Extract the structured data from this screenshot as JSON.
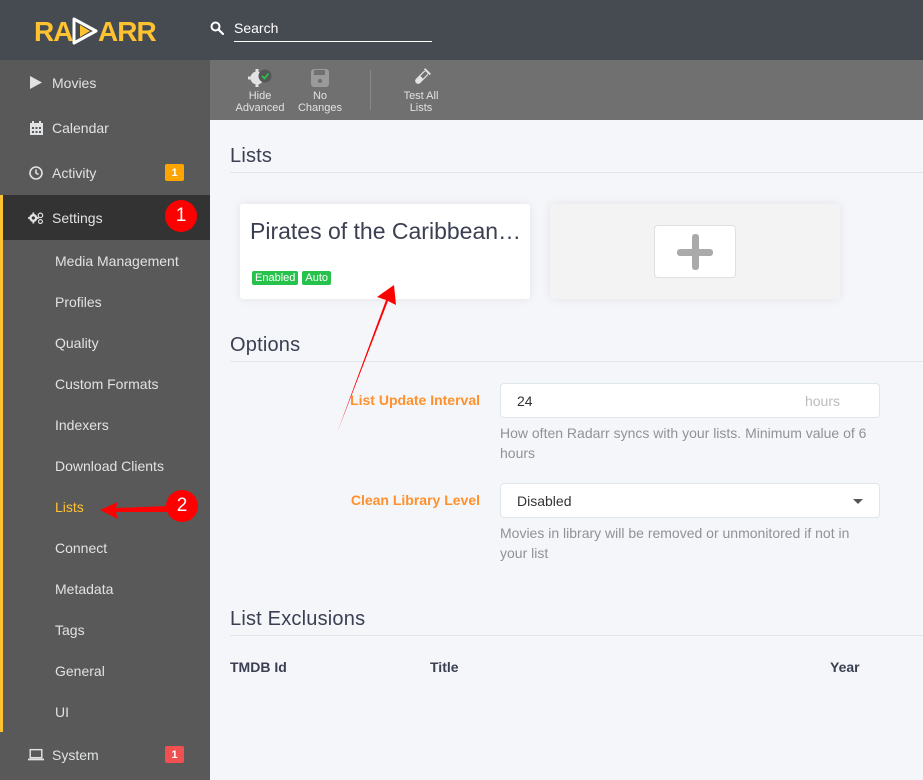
{
  "header": {
    "logo_text": "RADARR",
    "search_placeholder": "Search"
  },
  "sidebar": {
    "items": [
      {
        "label": "Movies",
        "icon": "play-icon"
      },
      {
        "label": "Calendar",
        "icon": "calendar-icon"
      },
      {
        "label": "Activity",
        "icon": "clock-icon",
        "badge": "1",
        "badge_color": "#ffa500"
      },
      {
        "label": "Settings",
        "icon": "gears-icon",
        "active": true
      },
      {
        "label": "System",
        "icon": "laptop-icon",
        "badge": "1",
        "badge_color": "#f05050"
      }
    ],
    "settings_sub": [
      {
        "label": "Media Management"
      },
      {
        "label": "Profiles"
      },
      {
        "label": "Quality"
      },
      {
        "label": "Custom Formats"
      },
      {
        "label": "Indexers"
      },
      {
        "label": "Download Clients"
      },
      {
        "label": "Lists",
        "current": true
      },
      {
        "label": "Connect"
      },
      {
        "label": "Metadata"
      },
      {
        "label": "Tags"
      },
      {
        "label": "General"
      },
      {
        "label": "UI"
      }
    ]
  },
  "toolbar": {
    "buttons": [
      {
        "line1": "Hide",
        "line2": "Advanced",
        "icon": "advanced-settings-icon"
      },
      {
        "line1": "No",
        "line2": "Changes",
        "icon": "save-icon"
      },
      {
        "line1": "Test All",
        "line2": "Lists",
        "icon": "test-tube-icon"
      }
    ]
  },
  "lists_section": {
    "title": "Lists",
    "cards": [
      {
        "name": "Pirates of the Caribbean…",
        "tags": [
          "Enabled",
          "Auto"
        ]
      }
    ],
    "add_icon": "plus-icon"
  },
  "options_section": {
    "title": "Options",
    "fields": [
      {
        "label": "List Update Interval",
        "value": "24",
        "unit": "hours",
        "help": "How often Radarr syncs with your lists. Minimum value of 6 hours"
      },
      {
        "label": "Clean Library Level",
        "value": "Disabled",
        "help": "Movies in library will be removed or unmonitored if not in your list"
      }
    ]
  },
  "exclusions_section": {
    "title": "List Exclusions",
    "columns": [
      "TMDB Id",
      "Title",
      "Year"
    ]
  },
  "annotations": {
    "step1": "1",
    "step2": "2"
  },
  "colors": {
    "accent": "#ffc230",
    "label_orange": "#ff902b",
    "tag_green": "#27c24c",
    "annotation_red": "#ff0000"
  }
}
